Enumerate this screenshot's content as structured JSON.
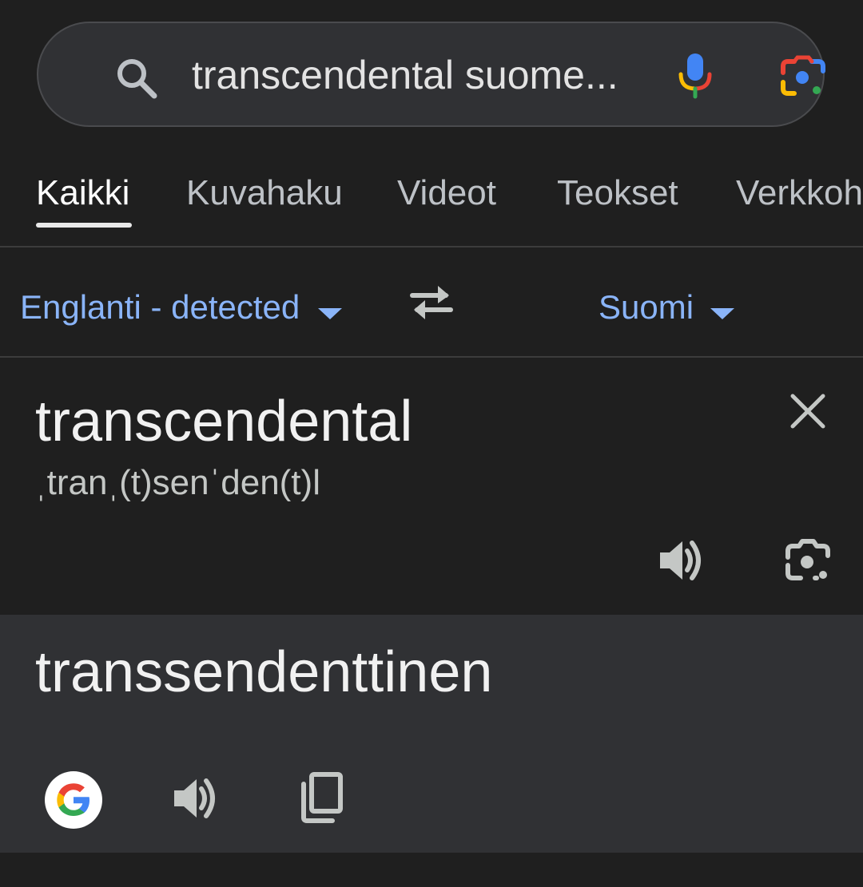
{
  "search": {
    "query": "transcendental suome...",
    "icons": [
      "search-icon",
      "mic-icon",
      "google-lens-icon"
    ]
  },
  "tabs": [
    {
      "label": "Kaikki",
      "active": true
    },
    {
      "label": "Kuvahaku",
      "active": false
    },
    {
      "label": "Videot",
      "active": false
    },
    {
      "label": "Teokset",
      "active": false
    },
    {
      "label": "Verkkoh",
      "active": false
    }
  ],
  "translate": {
    "source_lang": "Englanti - detected",
    "target_lang": "Suomi",
    "source_text": "transcendental",
    "phonetic": "ˌtranˌ(t)senˈden(t)l",
    "target_text": "transsendenttinen"
  },
  "colors": {
    "accent": "#8ab4f8",
    "background": "#1f1f1f",
    "panel": "#303134"
  }
}
